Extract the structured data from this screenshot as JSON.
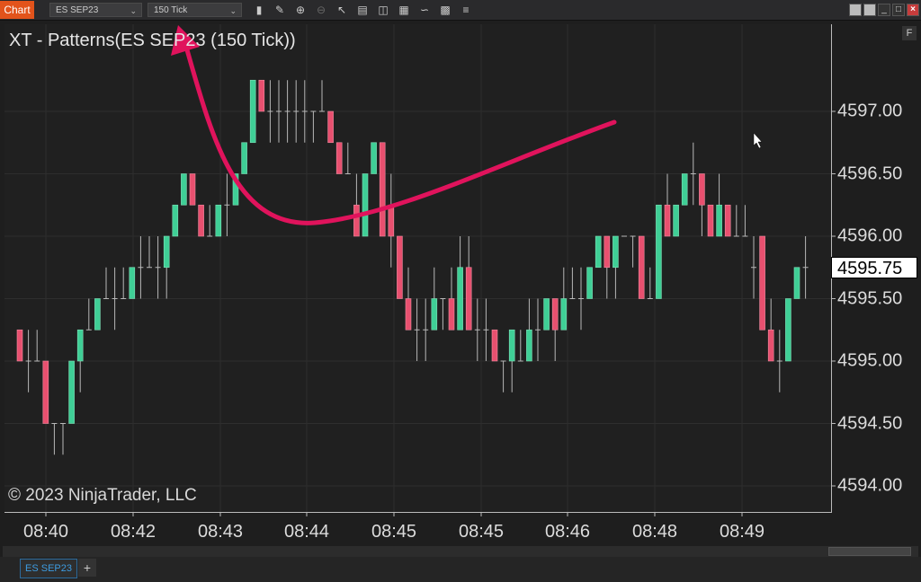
{
  "toolbar": {
    "chart_tab": "Chart",
    "instrument": "ES SEP23",
    "interval": "150 Tick",
    "tools": [
      "bar-type-icon",
      "pencil-icon",
      "zoom-in-icon",
      "zoom-out-icon",
      "pointer-icon",
      "properties-icon",
      "templates-icon",
      "strategies-icon",
      "indicators-icon",
      "data-box-icon",
      "menu-icon"
    ]
  },
  "chart": {
    "title": "XT - Patterns(ES SEP23 (150 Tick))",
    "copyright": "© 2023 NinjaTrader, LLC",
    "f_button": "F",
    "current_price": "4595.75",
    "colors": {
      "up": "#3fcf96",
      "down": "#e8506f",
      "annotation": "#e0135c",
      "background": "#202020"
    }
  },
  "chart_data": {
    "type": "candlestick",
    "y_ticks": [
      "4597.00",
      "4596.50",
      "4596.00",
      "4595.50",
      "4595.00",
      "4594.50",
      "4594.00"
    ],
    "x_ticks": [
      "08:40",
      "08:42",
      "08:43",
      "08:44",
      "08:45",
      "08:45",
      "08:46",
      "08:48",
      "08:49"
    ],
    "ylim": [
      4593.9,
      4597.5
    ],
    "tick_size": 0.25,
    "bars_ohlc": [
      [
        4595.25,
        4595.25,
        4595.0,
        4595.0
      ],
      [
        4595.0,
        4595.25,
        4594.75,
        4595.0
      ],
      [
        4595.0,
        4595.25,
        4595.0,
        4595.0
      ],
      [
        4595.0,
        4595.0,
        4594.5,
        4594.5
      ],
      [
        4594.5,
        4594.5,
        4594.25,
        4594.5
      ],
      [
        4594.5,
        4594.5,
        4594.25,
        4594.5
      ],
      [
        4594.5,
        4595.0,
        4594.5,
        4595.0
      ],
      [
        4595.0,
        4595.25,
        4594.75,
        4595.25
      ],
      [
        4595.25,
        4595.5,
        4595.25,
        4595.25
      ],
      [
        4595.25,
        4595.5,
        4595.25,
        4595.5
      ],
      [
        4595.5,
        4595.75,
        4595.5,
        4595.5
      ],
      [
        4595.5,
        4595.75,
        4595.25,
        4595.5
      ],
      [
        4595.5,
        4595.75,
        4595.5,
        4595.5
      ],
      [
        4595.5,
        4595.75,
        4595.5,
        4595.75
      ],
      [
        4595.75,
        4596.0,
        4595.5,
        4595.75
      ],
      [
        4595.75,
        4596.0,
        4595.75,
        4595.75
      ],
      [
        4595.75,
        4596.0,
        4595.5,
        4595.75
      ],
      [
        4595.75,
        4596.0,
        4595.5,
        4596.0
      ],
      [
        4596.0,
        4596.25,
        4596.0,
        4596.25
      ],
      [
        4596.25,
        4596.5,
        4596.25,
        4596.5
      ],
      [
        4596.5,
        4596.5,
        4596.25,
        4596.25
      ],
      [
        4596.25,
        4596.25,
        4596.0,
        4596.0
      ],
      [
        4596.0,
        4596.25,
        4596.0,
        4596.0
      ],
      [
        4596.0,
        4596.25,
        4596.0,
        4596.25
      ],
      [
        4596.25,
        4596.5,
        4596.0,
        4596.25
      ],
      [
        4596.25,
        4596.5,
        4596.25,
        4596.5
      ],
      [
        4596.5,
        4596.75,
        4596.5,
        4596.75
      ],
      [
        4596.75,
        4597.25,
        4596.75,
        4597.25
      ],
      [
        4597.25,
        4597.25,
        4597.0,
        4597.0
      ],
      [
        4597.0,
        4597.25,
        4596.75,
        4597.0
      ],
      [
        4597.0,
        4597.25,
        4596.75,
        4597.0
      ],
      [
        4597.0,
        4597.25,
        4596.75,
        4597.0
      ],
      [
        4597.0,
        4597.25,
        4596.75,
        4597.0
      ],
      [
        4597.0,
        4597.25,
        4596.75,
        4597.0
      ],
      [
        4597.0,
        4597.0,
        4596.75,
        4597.0
      ],
      [
        4597.0,
        4597.25,
        4597.0,
        4597.0
      ],
      [
        4597.0,
        4597.0,
        4596.75,
        4596.75
      ],
      [
        4596.75,
        4596.75,
        4596.5,
        4596.5
      ],
      [
        4596.5,
        4596.75,
        4596.5,
        4596.5
      ],
      [
        4596.25,
        4596.5,
        4596.0,
        4596.0
      ],
      [
        4596.0,
        4596.5,
        4596.0,
        4596.5
      ],
      [
        4596.5,
        4596.75,
        4596.5,
        4596.75
      ],
      [
        4596.75,
        4596.75,
        4596.0,
        4596.0
      ],
      [
        4596.25,
        4596.5,
        4595.75,
        4596.0
      ],
      [
        4596.0,
        4596.0,
        4595.5,
        4595.5
      ],
      [
        4595.5,
        4595.75,
        4595.25,
        4595.25
      ],
      [
        4595.25,
        4595.5,
        4595.0,
        4595.25
      ],
      [
        4595.25,
        4595.5,
        4595.0,
        4595.25
      ],
      [
        4595.25,
        4595.75,
        4595.25,
        4595.5
      ],
      [
        4595.5,
        4595.5,
        4595.25,
        4595.5
      ],
      [
        4595.5,
        4595.75,
        4595.25,
        4595.25
      ],
      [
        4595.25,
        4596.0,
        4595.25,
        4595.75
      ],
      [
        4595.75,
        4596.0,
        4595.25,
        4595.25
      ],
      [
        4595.25,
        4595.5,
        4595.0,
        4595.25
      ],
      [
        4595.25,
        4595.5,
        4595.0,
        4595.25
      ],
      [
        4595.25,
        4595.25,
        4595.0,
        4595.0
      ],
      [
        4595.0,
        4595.0,
        4594.75,
        4595.0
      ],
      [
        4595.0,
        4595.25,
        4594.75,
        4595.25
      ],
      [
        4595.0,
        4595.25,
        4595.0,
        4595.0
      ],
      [
        4595.0,
        4595.5,
        4595.0,
        4595.25
      ],
      [
        4595.25,
        4595.5,
        4595.0,
        4595.25
      ],
      [
        4595.25,
        4595.5,
        4595.25,
        4595.5
      ],
      [
        4595.5,
        4595.5,
        4595.0,
        4595.25
      ],
      [
        4595.25,
        4595.75,
        4595.25,
        4595.5
      ],
      [
        4595.5,
        4595.75,
        4595.5,
        4595.5
      ],
      [
        4595.5,
        4595.75,
        4595.25,
        4595.5
      ],
      [
        4595.5,
        4595.75,
        4595.5,
        4595.75
      ],
      [
        4595.75,
        4596.0,
        4595.75,
        4596.0
      ],
      [
        4596.0,
        4596.0,
        4595.5,
        4595.75
      ],
      [
        4595.75,
        4596.0,
        4595.5,
        4596.0
      ],
      [
        4596.0,
        4596.0,
        4596.0,
        4596.0
      ],
      [
        4596.0,
        4596.0,
        4595.75,
        4596.0
      ],
      [
        4596.0,
        4596.0,
        4595.5,
        4595.5
      ],
      [
        4595.5,
        4595.75,
        4595.5,
        4595.5
      ],
      [
        4595.5,
        4596.25,
        4595.5,
        4596.25
      ],
      [
        4596.25,
        4596.5,
        4596.0,
        4596.0
      ],
      [
        4596.0,
        4596.25,
        4596.0,
        4596.25
      ],
      [
        4596.25,
        4596.5,
        4596.25,
        4596.5
      ],
      [
        4596.5,
        4596.75,
        4596.25,
        4596.5
      ],
      [
        4596.5,
        4596.5,
        4596.0,
        4596.25
      ],
      [
        4596.25,
        4596.25,
        4596.0,
        4596.0
      ],
      [
        4596.0,
        4596.5,
        4596.0,
        4596.25
      ],
      [
        4596.25,
        4596.25,
        4596.0,
        4596.0
      ],
      [
        4596.0,
        4596.25,
        4596.0,
        4596.0
      ],
      [
        4596.0,
        4596.25,
        4596.0,
        4596.0
      ],
      [
        4595.75,
        4596.0,
        4595.5,
        4595.75
      ],
      [
        4596.0,
        4596.0,
        4595.25,
        4595.25
      ],
      [
        4595.25,
        4595.5,
        4595.0,
        4595.0
      ],
      [
        4595.0,
        4595.25,
        4594.75,
        4595.0
      ],
      [
        4595.0,
        4595.5,
        4595.0,
        4595.5
      ],
      [
        4595.5,
        4595.75,
        4595.5,
        4595.75
      ],
      [
        4595.75,
        4596.0,
        4595.5,
        4595.75
      ]
    ]
  },
  "bottom": {
    "instrument_tab": "ES SEP23",
    "add_tab": "+"
  }
}
